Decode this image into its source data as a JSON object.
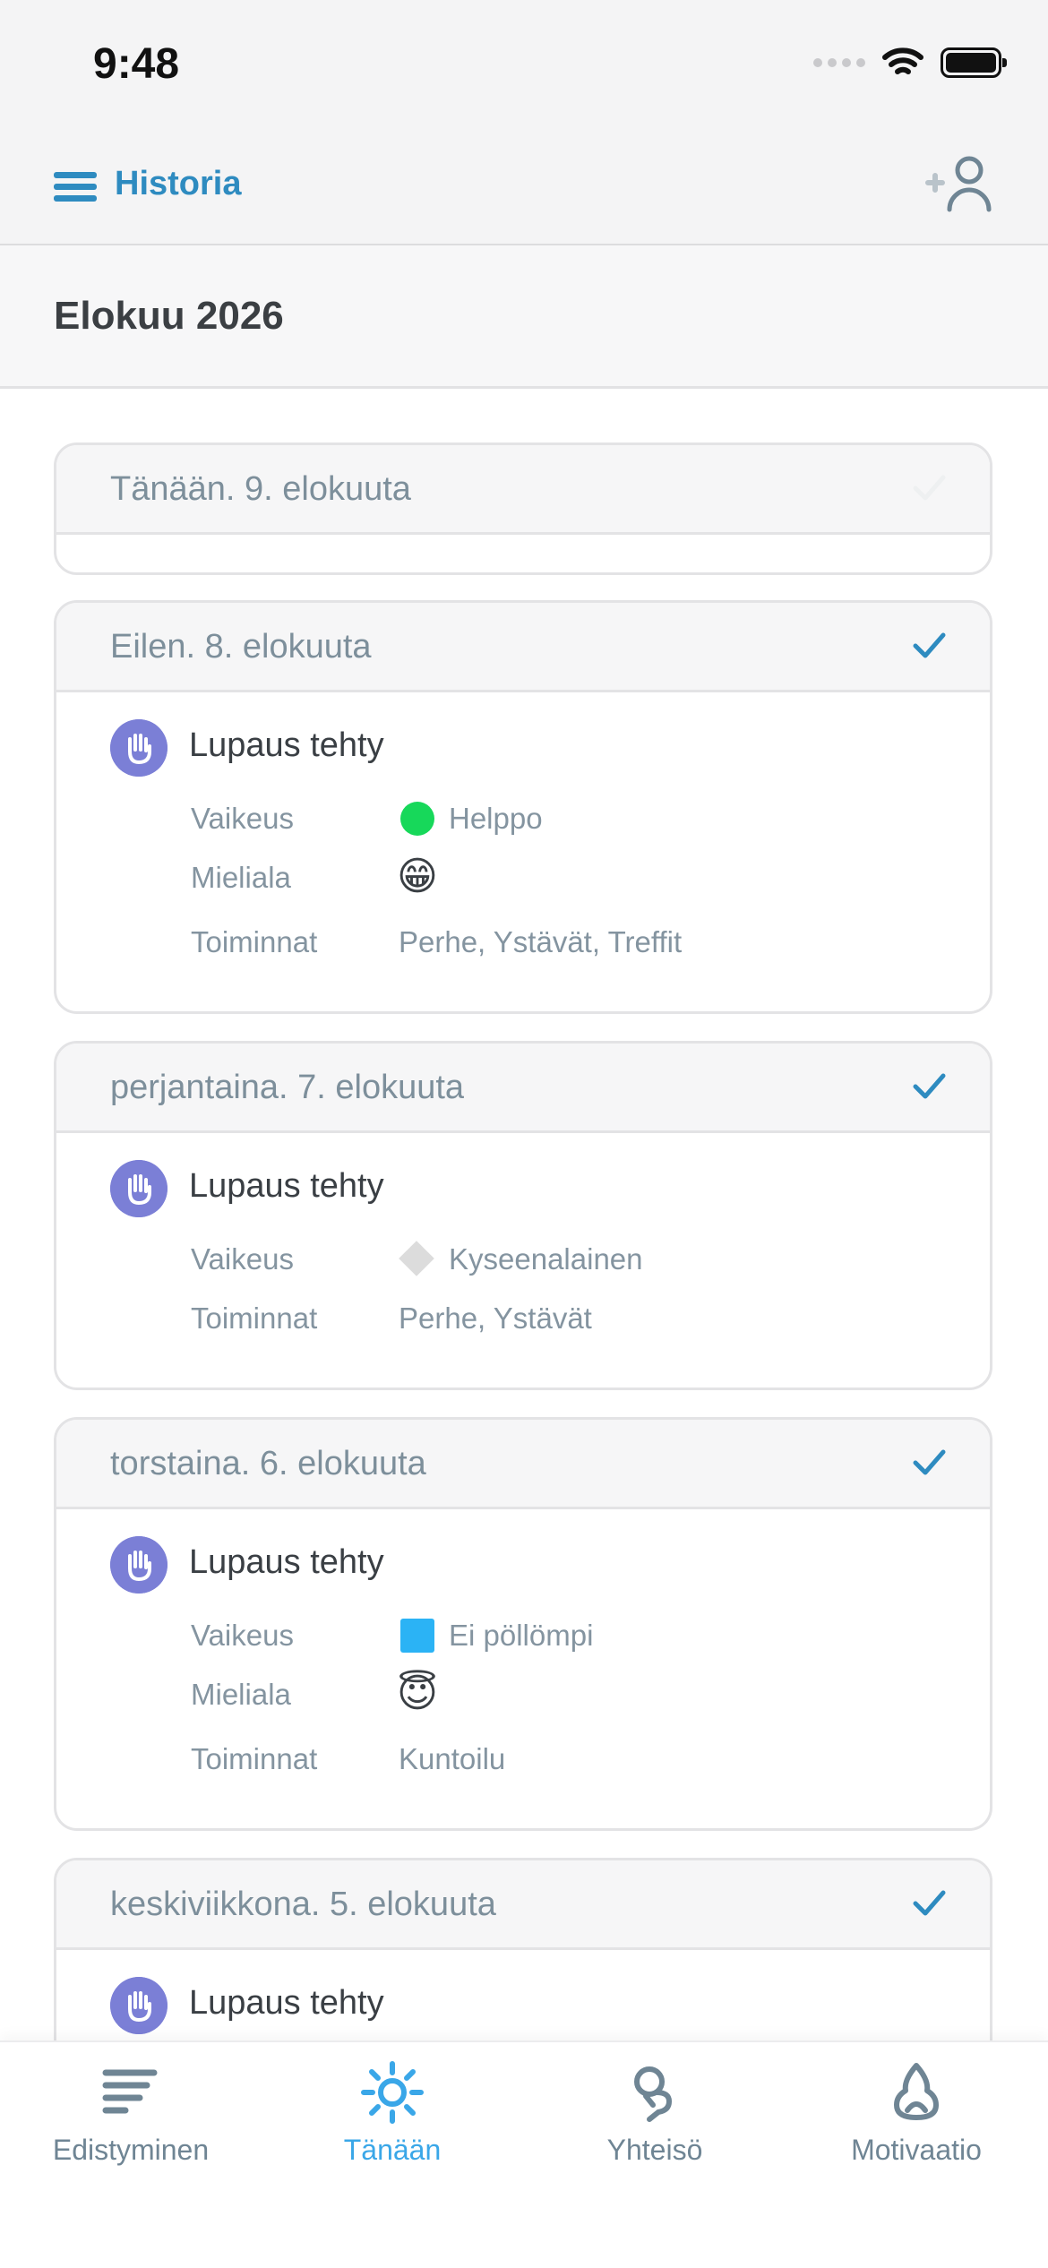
{
  "status_bar": {
    "time": "9:48"
  },
  "nav": {
    "title": "Historia"
  },
  "month": "Elokuu 2026",
  "days": [
    {
      "date": "Tänään. 9. elokuuta",
      "checked": true
    },
    {
      "date": "Eilen. 8. elokuuta",
      "checked": true,
      "promise": "Lupaus tehty",
      "difficulty_label": "Vaikeus",
      "difficulty": "Helppo",
      "mood_label": "Mieliala",
      "mood": "😁",
      "activities_label": "Toiminnat",
      "activities": "Perhe, Ystävät, Treffit"
    },
    {
      "date": "perjantaina. 7. elokuuta",
      "checked": true,
      "promise": "Lupaus tehty",
      "difficulty_label": "Vaikeus",
      "difficulty": "Kyseenalainen",
      "activities_label": "Toiminnat",
      "activities": "Perhe, Ystävät"
    },
    {
      "date": "torstaina. 6. elokuuta",
      "checked": true,
      "promise": "Lupaus tehty",
      "difficulty_label": "Vaikeus",
      "difficulty": "Ei pöllömpi",
      "mood_label": "Mieliala",
      "mood": "😇",
      "activities_label": "Toiminnat",
      "activities": "Kuntoilu"
    },
    {
      "date": "keskiviikkona. 5. elokuuta",
      "checked": true,
      "promise": "Lupaus tehty"
    }
  ],
  "tabs": [
    {
      "label": "Edistyminen",
      "icon": "progress-icon",
      "active": false
    },
    {
      "label": "Tänään",
      "icon": "sun-icon",
      "active": true
    },
    {
      "label": "Yhteisö",
      "icon": "community-icon",
      "active": false
    },
    {
      "label": "Motivaatio",
      "icon": "motivation-icon",
      "active": false
    }
  ],
  "colors": {
    "accent": "#2e8bc0",
    "tab_active": "#3aa7e8",
    "promise_icon_bg": "#7b7fd6",
    "easy": "#17d85a",
    "not_bad": "#2bb3f5",
    "questionable": "#dcdcdc"
  }
}
